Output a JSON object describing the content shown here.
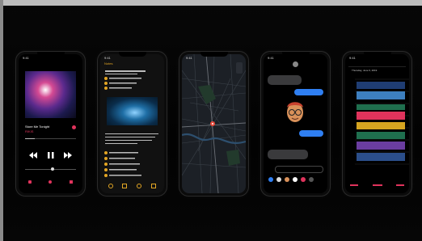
{
  "phones": [
    {
      "app": "Music",
      "status_time": "9:41",
      "song_title": "Store Me Tonight",
      "artist": "RIKIS"
    },
    {
      "app": "Notes",
      "status_time": "9:41",
      "back_label": "Notes"
    },
    {
      "app": "Maps",
      "status_time": "9:41"
    },
    {
      "app": "Messages",
      "status_time": "9:41"
    },
    {
      "app": "Calendar",
      "status_time": "9:41",
      "header": "Thursday, June 6, 2019"
    }
  ],
  "colors": {
    "background": "#000000",
    "accent_music": "#e0335c",
    "accent_notes": "#e3a624",
    "accent_calendar": "#e0335c",
    "imessage_blue": "#2f7ff2",
    "maps_pin": "#e74a3b"
  },
  "icons": [
    "play-pause-icon",
    "rewind-icon",
    "forward-icon",
    "location-pin-icon",
    "memoji-icon",
    "checklist-icon"
  ]
}
